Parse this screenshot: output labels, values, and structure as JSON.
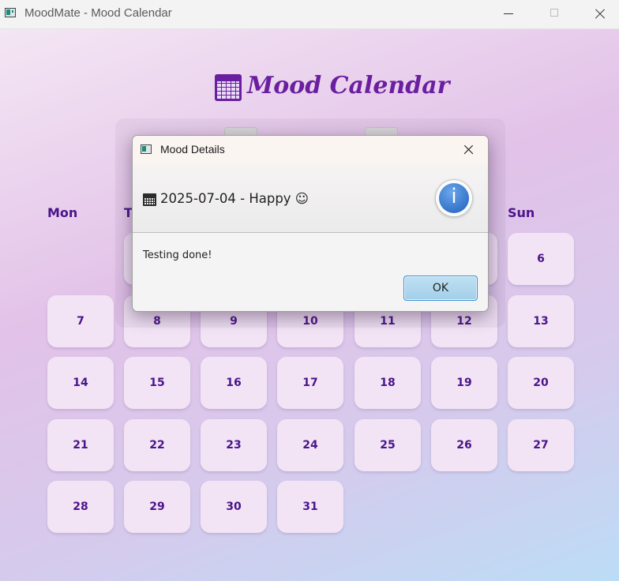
{
  "window": {
    "title": "MoodMate - Mood Calendar"
  },
  "page": {
    "heading": "Mood Calendar"
  },
  "weekdays": {
    "mon": "Mon",
    "tue": "T",
    "sun": "Sun"
  },
  "calendar": {
    "days": [
      "6",
      "7",
      "8",
      "9",
      "10",
      "11",
      "12",
      "13",
      "14",
      "15",
      "16",
      "17",
      "18",
      "19",
      "20",
      "21",
      "22",
      "23",
      "24",
      "25",
      "26",
      "27",
      "28",
      "29",
      "30",
      "31"
    ]
  },
  "dialog": {
    "title": "Mood Details",
    "header": "2025-07-04 - Happy ☺",
    "message": "Testing done!",
    "ok_label": "OK",
    "info_glyph": "i"
  },
  "colors": {
    "accent": "#6a1fa0",
    "day_text": "#4b148a",
    "cell_bg": "#f2e4f5",
    "ok_border": "#3b8fd0"
  }
}
